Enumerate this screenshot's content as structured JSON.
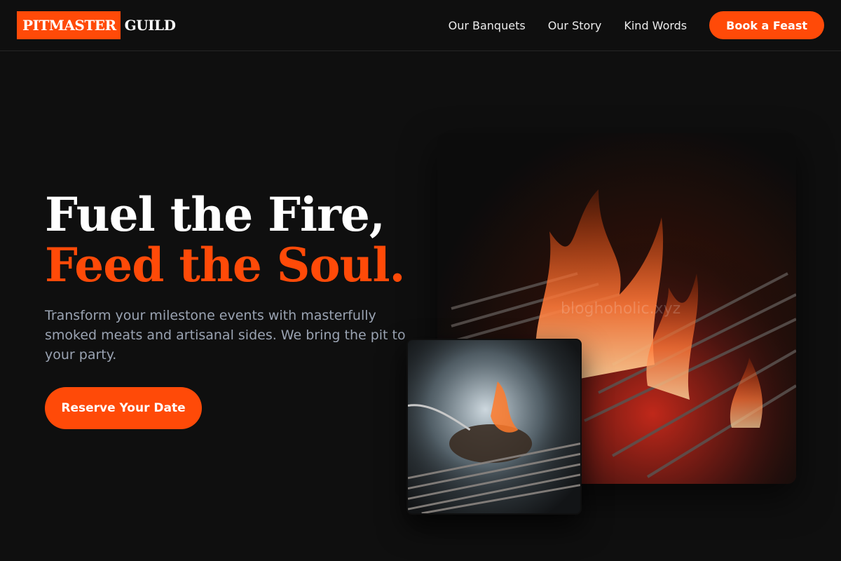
{
  "header": {
    "logo": {
      "mark": "PITMASTER",
      "word": "GUILD"
    },
    "nav": [
      {
        "label": "Our Banquets"
      },
      {
        "label": "Our Story"
      },
      {
        "label": "Kind Words"
      }
    ],
    "cta_label": "Book a Feast"
  },
  "hero": {
    "title_line1": "Fuel the Fire,",
    "title_line2": "Feed the Soul.",
    "subtitle": "Transform your milestone events with masterfully smoked meats and artisanal sides. We bring the pit to your party.",
    "cta_label": "Reserve Your Date",
    "watermark": "bloghoholic.xyz"
  },
  "colors": {
    "background": "#0f0f0f",
    "accent": "#ff4a08",
    "subtitle": "#9aa3b2"
  },
  "images": {
    "main": "fire-grill-photo",
    "secondary": "smoking-meat-grill-photo"
  }
}
